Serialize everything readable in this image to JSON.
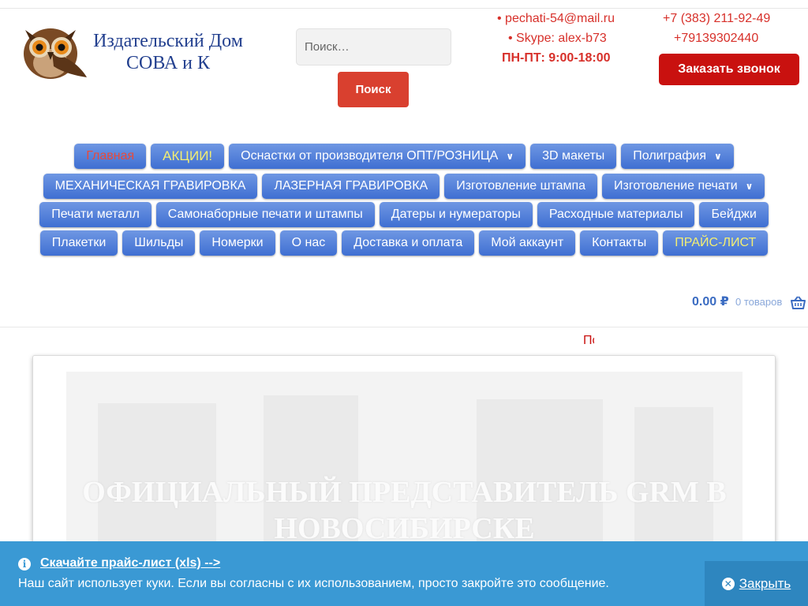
{
  "header": {
    "logo": {
      "line1": "Издательский Дом",
      "line2": "СОВА и К",
      "icon": "owl-logo"
    },
    "search": {
      "placeholder": "Поиск…",
      "button_label": "Поиск"
    },
    "contacts": {
      "email": "• pechati-54@mail.ru",
      "skype": "• Skype: alex-b73",
      "hours": "ПН-ПТ: 9:00-18:00",
      "phone1": "+7 (383) 211-92-49",
      "phone2": "+79139302440",
      "callback_label": "Заказать звонок"
    }
  },
  "nav": {
    "rows": [
      [
        {
          "label": "Главная"
        },
        {
          "label": "АКЦИИ!"
        },
        {
          "label": "Оснастки от производителя ОПТ/РОЗНИЦА",
          "dropdown": true
        },
        {
          "label": "3D макеты"
        },
        {
          "label": "Полиграфия",
          "dropdown": true
        }
      ],
      [
        {
          "label": "МЕХАНИЧЕСКАЯ ГРАВИРОВКА"
        },
        {
          "label": "ЛАЗЕРНАЯ ГРАВИРОВКА"
        },
        {
          "label": "Изготовление штампа"
        },
        {
          "label": "Изготовление печати",
          "dropdown": true
        }
      ],
      [
        {
          "label": "Печати металл"
        },
        {
          "label": "Самонаборные печати и штампы"
        },
        {
          "label": "Датеры и нумераторы"
        },
        {
          "label": "Расходные материалы"
        },
        {
          "label": "Бейджи"
        }
      ],
      [
        {
          "label": "Плакетки"
        },
        {
          "label": "Шильды"
        },
        {
          "label": "Номерки"
        },
        {
          "label": "О нас"
        },
        {
          "label": "Доставка и оплата"
        },
        {
          "label": "Мой аккаунт"
        },
        {
          "label": "Контакты"
        },
        {
          "label": "ПРАЙС-ЛИСТ"
        }
      ]
    ]
  },
  "cart": {
    "total": "0.00 ₽",
    "count": "0 товаров",
    "icon": "basket-icon"
  },
  "ticker": {
    "text": "По"
  },
  "banner": {
    "title_line1": "ОФИЦИАЛЬНЫЙ ПРЕДСТАВИТЕЛЬ GRM В",
    "title_line2": "НОВОСИБИРСКЕ"
  },
  "cookie": {
    "link_text": "Скачайте прайс-лист (xls) -->",
    "message": "Наш сайт использует куки. Если вы согласны с их использованием, просто закройте это сообщение.",
    "close_label": "Закрыть",
    "icons": [
      "info-icon",
      "close-circle-icon"
    ]
  },
  "colors": {
    "nav_blue": "#4a78d6",
    "red": "#d7302a",
    "cookie_blue": "#3a99d4",
    "logo_blue": "#23408f"
  }
}
